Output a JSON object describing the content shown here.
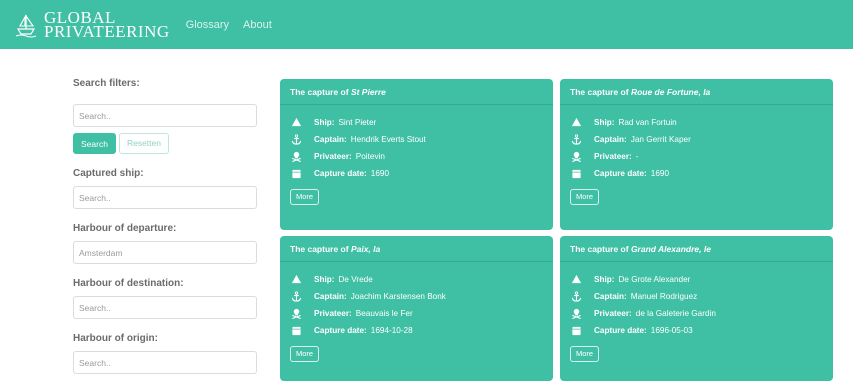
{
  "navbar": {
    "brand_line1": "GLOBAL",
    "brand_line2": "PRIVATEERING",
    "links": [
      "Glossary",
      "About"
    ]
  },
  "sidebar": {
    "title": "Search filters:",
    "search_placeholder": "Search..",
    "search_button": "Search",
    "reset_button": "Resetten",
    "captured_ship_label": "Captured ship:",
    "captured_ship_placeholder": "Search..",
    "departure_label": "Harbour of departure:",
    "departure_value": "Amsterdam",
    "destination_label": "Harbour of destination:",
    "destination_placeholder": "Search..",
    "origin_label": "Harbour of origin:",
    "origin_placeholder": "Search.."
  },
  "labels": {
    "ship": "Ship:",
    "captain": "Captain:",
    "privateer": "Privateer:",
    "capture_date": "Capture date:",
    "more": "More",
    "capture_prefix": "The capture of"
  },
  "cards": [
    {
      "title": "St Pierre",
      "ship": "Sint Pieter",
      "captain": "Hendrik Everts Stout",
      "privateer": "Poitevin",
      "capture_date": "1690"
    },
    {
      "title": "Roue de Fortune, la",
      "ship": "Rad van Fortuin",
      "captain": "Jan Gerrit Kaper",
      "privateer": "-",
      "capture_date": "1690"
    },
    {
      "title": "Paix, la",
      "ship": "De Vrede",
      "captain": "Joachim Karstensen Bonk",
      "privateer": "Beauvais le Fer",
      "capture_date": "1694-10-28"
    },
    {
      "title": "Grand Alexandre, le",
      "ship": "De Grote Alexander",
      "captain": "Manuel Rodriguez",
      "privateer": "de la Galeterie Gardin",
      "capture_date": "1696-05-03"
    }
  ],
  "colors": {
    "accent": "#3fbfa4",
    "background": "#ffffff"
  },
  "icons": [
    "ship-icon",
    "anchor-icon",
    "skull-icon",
    "calendar-icon"
  ]
}
